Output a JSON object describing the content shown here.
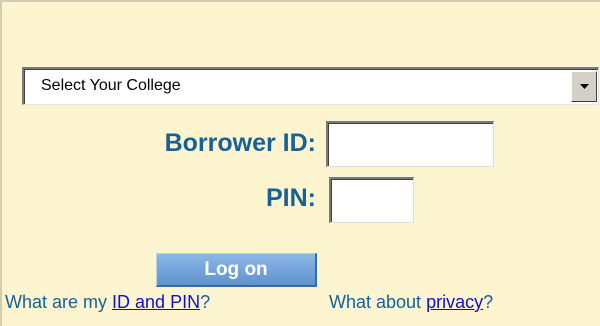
{
  "login": {
    "college_select": {
      "selected": "Select Your College"
    },
    "borrower_id": {
      "label": "Borrower ID:",
      "value": ""
    },
    "pin": {
      "label": "PIN:",
      "value": ""
    },
    "logon_label": "Log on",
    "help": {
      "id_prefix": "What are my ",
      "id_link": "ID and PIN",
      "id_suffix": "?",
      "privacy_prefix": "What about ",
      "privacy_link": "privacy",
      "privacy_suffix": "?"
    }
  },
  "colors": {
    "panel_bg": "#fdf5cf",
    "label_blue": "#15619a",
    "link_blue": "#1010c8",
    "button_blue": "#6e9fd8"
  },
  "icons": {
    "dropdown": "triangle-down"
  }
}
